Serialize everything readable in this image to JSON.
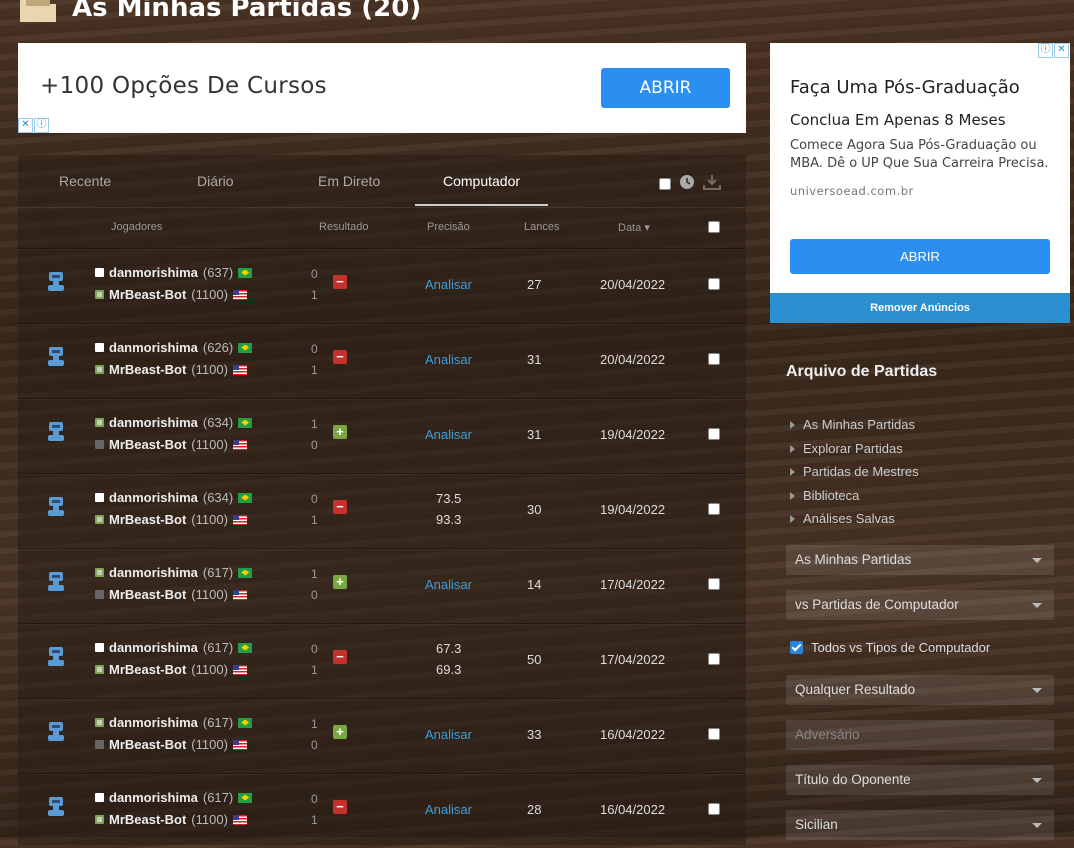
{
  "header": {
    "title": "As Minhas Partidas (20)"
  },
  "ad_top": {
    "text": "+100 Opções De Cursos",
    "button": "ABRIR"
  },
  "tabs": [
    "Recente",
    "Diário",
    "Em Direto",
    "Computador"
  ],
  "active_tab": "Computador",
  "columns": {
    "players": "Jogadores",
    "result": "Resultado",
    "accuracy": "Precisão",
    "moves": "Lances",
    "date": "Data"
  },
  "games": [
    {
      "white": "danmorishima",
      "white_rating": "(637)",
      "black": "MrBeast-Bot",
      "black_rating": "(1100)",
      "score_white": "0",
      "score_black": "1",
      "result": "loss",
      "analyse": "Analisar",
      "moves": "27",
      "date": "20/04/2022"
    },
    {
      "white": "danmorishima",
      "white_rating": "(626)",
      "black": "MrBeast-Bot",
      "black_rating": "(1100)",
      "score_white": "0",
      "score_black": "1",
      "result": "loss",
      "analyse": "Analisar",
      "moves": "31",
      "date": "20/04/2022"
    },
    {
      "white": "danmorishima",
      "white_rating": "(634)",
      "black": "MrBeast-Bot",
      "black_rating": "(1100)",
      "score_white": "1",
      "score_black": "0",
      "result": "win",
      "analyse": "Analisar",
      "moves": "31",
      "date": "19/04/2022"
    },
    {
      "white": "danmorishima",
      "white_rating": "(634)",
      "black": "MrBeast-Bot",
      "black_rating": "(1100)",
      "score_white": "0",
      "score_black": "1",
      "result": "loss",
      "acc_white": "73.5",
      "acc_black": "93.3",
      "moves": "30",
      "date": "19/04/2022"
    },
    {
      "white": "danmorishima",
      "white_rating": "(617)",
      "black": "MrBeast-Bot",
      "black_rating": "(1100)",
      "score_white": "1",
      "score_black": "0",
      "result": "win",
      "analyse": "Analisar",
      "moves": "14",
      "date": "17/04/2022"
    },
    {
      "white": "danmorishima",
      "white_rating": "(617)",
      "black": "MrBeast-Bot",
      "black_rating": "(1100)",
      "score_white": "0",
      "score_black": "1",
      "result": "loss",
      "acc_white": "67.3",
      "acc_black": "69.3",
      "moves": "50",
      "date": "17/04/2022"
    },
    {
      "white": "danmorishima",
      "white_rating": "(617)",
      "black": "MrBeast-Bot",
      "black_rating": "(1100)",
      "score_white": "1",
      "score_black": "0",
      "result": "win",
      "analyse": "Analisar",
      "moves": "33",
      "date": "16/04/2022"
    },
    {
      "white": "danmorishima",
      "white_rating": "(617)",
      "black": "MrBeast-Bot",
      "black_rating": "(1100)",
      "score_white": "0",
      "score_black": "1",
      "result": "loss",
      "analyse": "Analisar",
      "moves": "28",
      "date": "16/04/2022"
    }
  ],
  "ad_side": {
    "title": "Faça Uma Pós-Graduação",
    "subtitle": "Conclua Em Apenas 8 Meses",
    "body": "Comece Agora Sua Pós-Graduação ou MBA. Dê o UP Que Sua Carreira Precisa.",
    "domain": "universoead.com.br",
    "button": "ABRIR"
  },
  "remove_ads": "Remover Anúncios",
  "archive": {
    "title": "Arquivo de Partidas",
    "links": [
      "As Minhas Partidas",
      "Explorar Partidas",
      "Partidas de Mestres",
      "Biblioteca",
      "Análises Salvas"
    ],
    "filters": {
      "scope": "As Minhas Partidas",
      "type": "vs Partidas de Computador",
      "all_types": "Todos vs Tipos de Computador",
      "result": "Qualquer Resultado",
      "opponent_placeholder": "Adversário",
      "opponent_title": "Título do Oponente",
      "opening": "Sicilian"
    }
  },
  "colors": {
    "link": "#3e9dd8",
    "loss": "#c7312c",
    "win": "#79a843",
    "ad_button": "#2b8ef1"
  }
}
